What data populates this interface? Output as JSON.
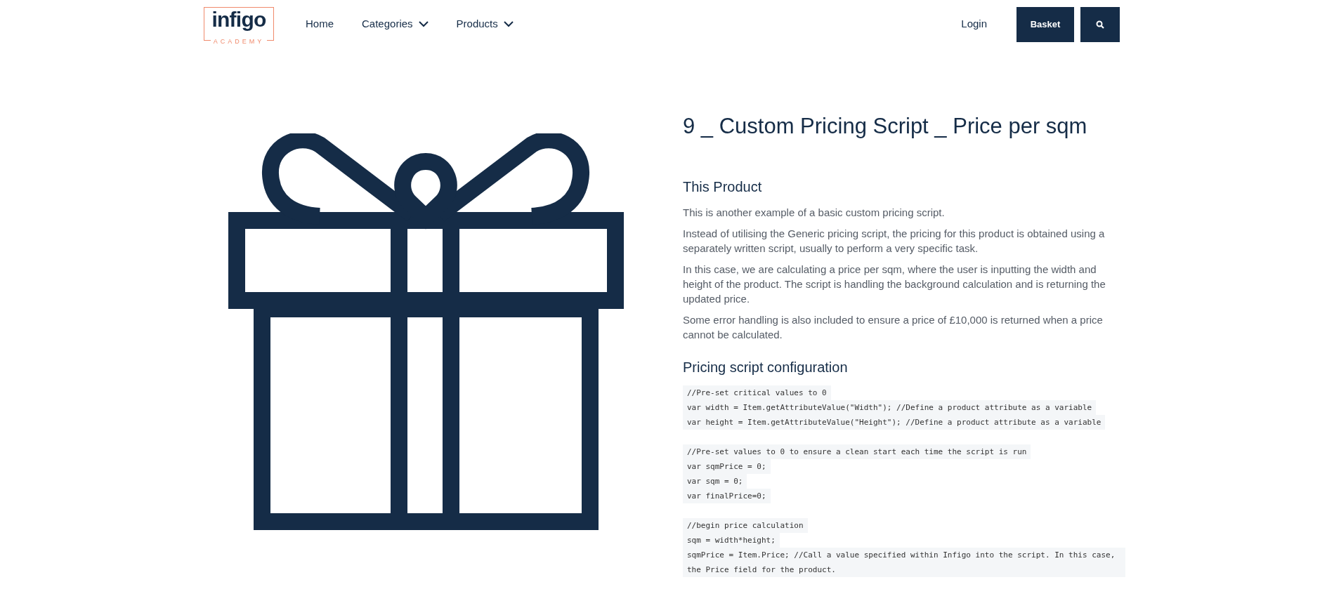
{
  "header": {
    "logo": {
      "name": "infigo",
      "tagline": "ACADEMY"
    },
    "nav": [
      {
        "label": "Home",
        "dropdown": false
      },
      {
        "label": "Categories",
        "dropdown": true
      },
      {
        "label": "Products",
        "dropdown": true
      }
    ],
    "login": "Login",
    "basket": "Basket"
  },
  "product": {
    "title": "9 _ Custom Pricing Script _ Price per sqm",
    "sections": [
      {
        "kind": "text",
        "heading": "This Product",
        "paragraphs": [
          "This is another example of a basic custom pricing script.",
          "Instead of utilising the Generic pricing script, the pricing for this product is obtained using a separately written script, usually to perform a very specific task.",
          "In this case, we are calculating a price per sqm, where the user is inputting the width and height of the product. The script is handling the background calculation and is returning the updated price.",
          "Some error handling is also included to ensure a price of £10,000 is returned when a price cannot be calculated."
        ]
      },
      {
        "kind": "code",
        "heading": "Pricing script configuration",
        "blocks": [
          [
            "//Pre-set critical values to 0",
            "var width = Item.getAttributeValue(\"Width\"); //Define a product attribute as a variable",
            "var height = Item.getAttributeValue(\"Height\"); //Define a product attribute as a variable"
          ],
          [
            "//Pre-set values to 0 to ensure a clean start each time the script is run",
            "var sqmPrice = 0;",
            "var sqm = 0;",
            "var finalPrice=0;"
          ],
          [
            "//begin price calculation",
            "sqm = width*height;",
            "sqmPrice = Item.Price; //Call a value specified within Infigo into the script. In this case, the Price field for the product."
          ]
        ]
      }
    ]
  }
}
